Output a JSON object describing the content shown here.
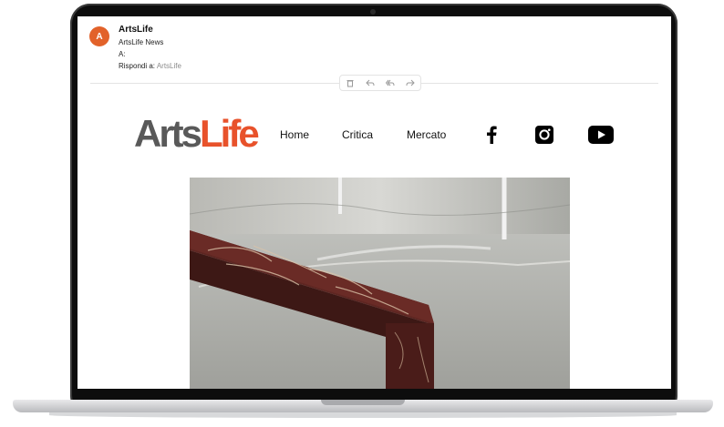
{
  "email": {
    "avatar_letter": "A",
    "sender": "ArtsLife",
    "from_line": "ArtsLife News",
    "to_label": "A:",
    "reply_label": "Rispondi a:",
    "reply_value": "ArtsLife"
  },
  "toolbar": {
    "icons": [
      "trash-icon",
      "reply-icon",
      "reply-all-icon",
      "forward-icon"
    ]
  },
  "newsletter": {
    "logo_arts": "Arts",
    "logo_life": "Life",
    "nav": [
      "Home",
      "Critica",
      "Mercato"
    ],
    "social": [
      "facebook-icon",
      "instagram-icon",
      "youtube-icon"
    ]
  },
  "colors": {
    "avatar": "#e2622a",
    "logo_gray": "#595959",
    "logo_orange": "#e8522b"
  }
}
